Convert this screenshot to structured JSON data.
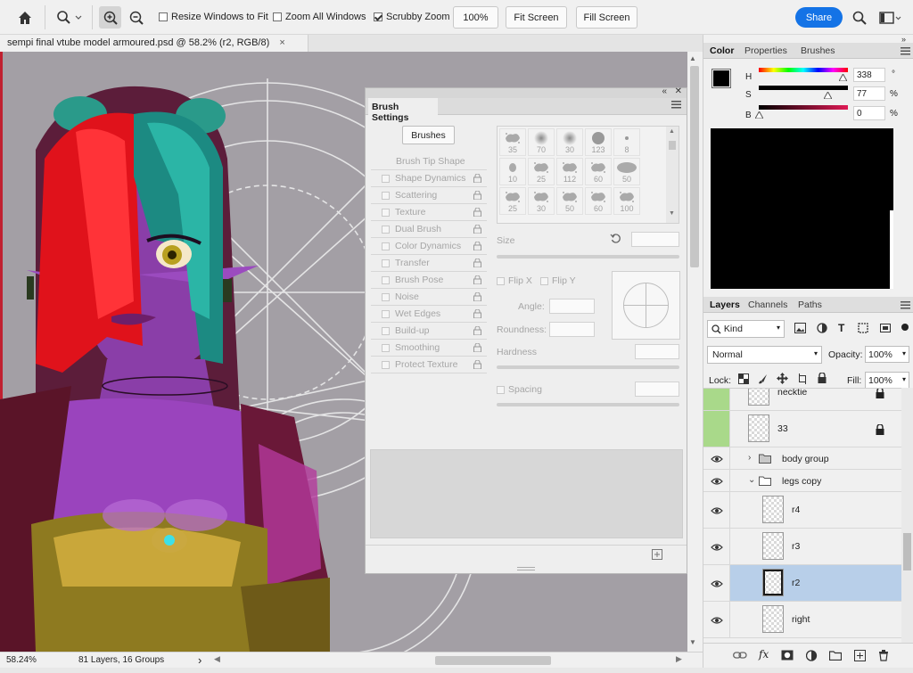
{
  "toolbar": {
    "resize_windows": "Resize Windows to Fit",
    "zoom_all": "Zoom All Windows",
    "scrubby_zoom": "Scrubby Zoom",
    "zoom_value": "100%",
    "fit_screen": "Fit Screen",
    "fill_screen": "Fill Screen",
    "share": "Share",
    "resize_checked": false,
    "zoom_all_checked": false,
    "scrubby_checked": true
  },
  "document": {
    "tab_title": "sempi final vtube model armoured.psd @ 58.2% (r2, RGB/8)",
    "close": "×"
  },
  "status": {
    "zoom": "58.24%",
    "info": "81 Layers, 16 Groups",
    "arrow": "›"
  },
  "brush_settings": {
    "title": "Brush Settings",
    "brushes_button": "Brushes",
    "options": [
      {
        "label": "Brush Tip Shape",
        "checkbox": false,
        "lock": false
      },
      {
        "label": "Shape Dynamics",
        "checkbox": true,
        "lock": true
      },
      {
        "label": "Scattering",
        "checkbox": true,
        "lock": true
      },
      {
        "label": "Texture",
        "checkbox": true,
        "lock": true
      },
      {
        "label": "Dual Brush",
        "checkbox": true,
        "lock": true
      },
      {
        "label": "Color Dynamics",
        "checkbox": true,
        "lock": true
      },
      {
        "label": "Transfer",
        "checkbox": true,
        "lock": true
      },
      {
        "label": "Brush Pose",
        "checkbox": true,
        "lock": true
      },
      {
        "label": "Noise",
        "checkbox": true,
        "lock": true
      },
      {
        "label": "Wet Edges",
        "checkbox": true,
        "lock": true
      },
      {
        "label": "Build-up",
        "checkbox": true,
        "lock": true
      },
      {
        "label": "Smoothing",
        "checkbox": true,
        "lock": true
      },
      {
        "label": "Protect Texture",
        "checkbox": true,
        "lock": true
      }
    ],
    "presets": [
      [
        "35",
        "70",
        "30",
        "123",
        "8"
      ],
      [
        "10",
        "25",
        "112",
        "60",
        "50"
      ],
      [
        "25",
        "30",
        "50",
        "60",
        "100"
      ]
    ],
    "size_label": "Size",
    "flip_x": "Flip X",
    "flip_y": "Flip Y",
    "angle_label": "Angle:",
    "roundness_label": "Roundness:",
    "hardness_label": "Hardness",
    "spacing_label": "Spacing"
  },
  "color_panel": {
    "tabs": [
      "Color",
      "Properties",
      "Brushes"
    ],
    "h_label": "H",
    "s_label": "S",
    "b_label": "B",
    "h_value": "338",
    "s_value": "77",
    "b_value": "0",
    "h_unit": "°",
    "s_unit": "%",
    "b_unit": "%",
    "h_level": 0.94,
    "s_level": 0.77,
    "b_level": 0.0,
    "foreground": "#000000",
    "background": "#000000"
  },
  "layers_panel": {
    "tabs": [
      "Layers",
      "Channels",
      "Paths"
    ],
    "kind": "Kind",
    "blend_mode": "Normal",
    "opacity_label": "Opacity:",
    "opacity_value": "100%",
    "lock_label": "Lock:",
    "fill_label": "Fill:",
    "fill_value": "100%",
    "layers": [
      {
        "name": "necktie",
        "type": "layer",
        "visible": false,
        "locked": true,
        "selected": false
      },
      {
        "name": "33",
        "type": "layer",
        "visible": false,
        "locked": true,
        "selected": false
      },
      {
        "name": "body group",
        "type": "group",
        "visible": true,
        "locked": false,
        "selected": false,
        "expanded": false
      },
      {
        "name": "legs copy",
        "type": "group",
        "visible": true,
        "locked": false,
        "selected": false,
        "expanded": true
      },
      {
        "name": "r4",
        "type": "layer",
        "visible": true,
        "locked": false,
        "selected": false
      },
      {
        "name": "r3",
        "type": "layer",
        "visible": true,
        "locked": false,
        "selected": false
      },
      {
        "name": "r2",
        "type": "layer",
        "visible": true,
        "locked": false,
        "selected": true
      },
      {
        "name": "right",
        "type": "layer",
        "visible": true,
        "locked": false,
        "selected": false
      }
    ],
    "footer_fx": "fx"
  },
  "colors": {
    "accent": "#1473e6",
    "selected_layer": "#b8cfe9",
    "hidden_layer_cell": "#a9d98a",
    "canvas_bg": "#a39fa5"
  }
}
